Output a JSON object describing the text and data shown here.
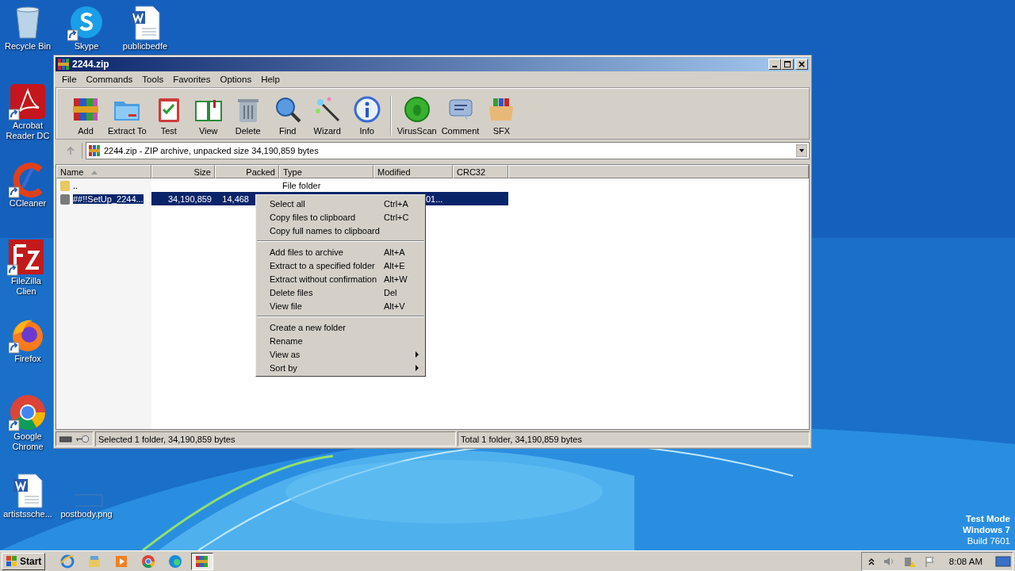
{
  "desktop_icons": [
    {
      "label": "Recycle Bin",
      "kind": "recycle-bin",
      "shortcut": false
    },
    {
      "label": "Skype",
      "kind": "skype",
      "shortcut": true
    },
    {
      "label": "publicbedfe",
      "kind": "word-doc",
      "shortcut": false
    },
    {
      "label": "Acrobat Reader DC",
      "kind": "acrobat",
      "shortcut": true
    },
    {
      "label": "CCleaner",
      "kind": "ccleaner",
      "shortcut": true
    },
    {
      "label": "FileZilla Clien",
      "kind": "filezilla",
      "shortcut": true
    },
    {
      "label": "Firefox",
      "kind": "firefox",
      "shortcut": true
    },
    {
      "label": "Google Chrome",
      "kind": "chrome",
      "shortcut": true
    },
    {
      "label": "artistssche...",
      "kind": "word-doc",
      "shortcut": false
    },
    {
      "label": "postbody.png",
      "kind": "blank",
      "shortcut": false
    }
  ],
  "window": {
    "title": "2244.zip",
    "menu": [
      "File",
      "Commands",
      "Tools",
      "Favorites",
      "Options",
      "Help"
    ],
    "toolbar": [
      {
        "label": "Add",
        "kind": "add"
      },
      {
        "label": "Extract To",
        "kind": "extract"
      },
      {
        "label": "Test",
        "kind": "test"
      },
      {
        "label": "View",
        "kind": "view"
      },
      {
        "label": "Delete",
        "kind": "delete"
      },
      {
        "label": "Find",
        "kind": "find"
      },
      {
        "label": "Wizard",
        "kind": "wizard"
      },
      {
        "label": "Info",
        "kind": "info"
      },
      {
        "label": "VirusScan",
        "kind": "virus"
      },
      {
        "label": "Comment",
        "kind": "comment"
      },
      {
        "label": "SFX",
        "kind": "sfx"
      }
    ],
    "address": "2244.zip - ZIP archive, unpacked size 34,190,859 bytes",
    "columns": [
      {
        "label": "Name",
        "sorted": true
      },
      {
        "label": "Size",
        "sorted": false
      },
      {
        "label": "Packed",
        "sorted": false
      },
      {
        "label": "Type",
        "sorted": false
      },
      {
        "label": "Modified",
        "sorted": false
      },
      {
        "label": "CRC32",
        "sorted": false
      }
    ],
    "rows": [
      {
        "kind": "parent",
        "name": "..",
        "type": "File folder",
        "selected": false
      },
      {
        "kind": "folder",
        "name": "##!!SetUp_2244...",
        "size": "34,190,859",
        "packed": "14,468",
        "modified": "01...",
        "selected": true
      }
    ],
    "status_left": "Selected 1 folder, 34,190,859 bytes",
    "status_right": "Total 1 folder, 34,190,859 bytes"
  },
  "context_menu": [
    [
      {
        "label": "Select all",
        "shortcut": "Ctrl+A",
        "submenu": false
      },
      {
        "label": "Copy files to clipboard",
        "shortcut": "Ctrl+C",
        "submenu": false
      },
      {
        "label": "Copy full names to clipboard",
        "submenu": false
      }
    ],
    [
      {
        "label": "Add files to archive",
        "shortcut": "Alt+A",
        "submenu": false
      },
      {
        "label": "Extract to a specified folder",
        "shortcut": "Alt+E",
        "submenu": false
      },
      {
        "label": "Extract without confirmation",
        "shortcut": "Alt+W",
        "submenu": false
      },
      {
        "label": "Delete files",
        "shortcut": "Del",
        "submenu": false
      },
      {
        "label": "View file",
        "shortcut": "Alt+V",
        "submenu": false
      }
    ],
    [
      {
        "label": "Create a new folder",
        "submenu": false
      },
      {
        "label": "Rename",
        "submenu": false
      },
      {
        "label": "View as",
        "submenu": true
      },
      {
        "label": "Sort by",
        "submenu": true
      }
    ]
  ],
  "test_mode": [
    "Test Mode",
    "Windows 7",
    "Build 7601"
  ],
  "taskbar": {
    "start": "Start",
    "apps": [
      {
        "kind": "ie",
        "active": false
      },
      {
        "kind": "explorer",
        "active": false
      },
      {
        "kind": "media",
        "active": false
      },
      {
        "kind": "chrome",
        "active": false
      },
      {
        "kind": "edge",
        "active": false
      },
      {
        "kind": "winrar",
        "active": true
      }
    ],
    "clock": "8:08 AM"
  }
}
